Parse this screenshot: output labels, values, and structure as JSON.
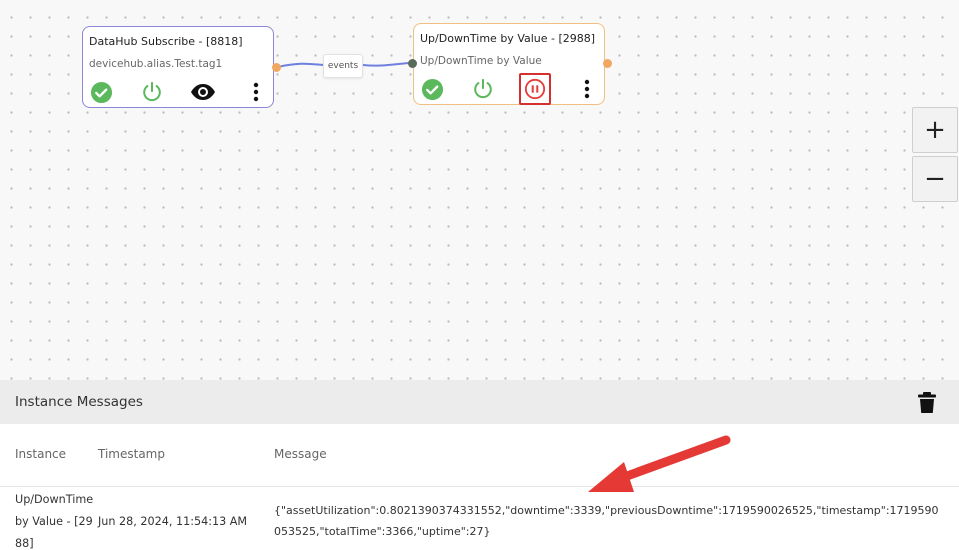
{
  "nodes": [
    {
      "title": "DataHub Subscribe - [8818]",
      "subtitle": "devicehub.alias.Test.tag1"
    },
    {
      "title": "Up/DownTime by Value - [2988]",
      "subtitle": "Up/DownTime by Value"
    }
  ],
  "edge": {
    "label": "events"
  },
  "zoom": {
    "in_label": "+",
    "out_label": "−"
  },
  "panel": {
    "title": "Instance Messages",
    "columns": {
      "instance": "Instance",
      "timestamp": "Timestamp",
      "message": "Message"
    },
    "rows": [
      {
        "instance": "Up/DownTime by Value - [2988]",
        "timestamp": "Jun 28, 2024, 11:54:13 AM",
        "message": "{\"assetUtilization\":0.8021390374331552,\"downtime\":3339,\"previousDowntime\":1719590026525,\"timestamp\":1719590053525,\"totalTime\":3366,\"uptime\":27}"
      }
    ]
  },
  "colors": {
    "check": "#5cb85c",
    "power": "#5cb85c",
    "pause": "#e53b3b",
    "highlight": "#d62f2f",
    "node_a_border": "#8b86d8",
    "node_b_border": "#f0c080",
    "edge": "#6f7fe0",
    "arrow": "#e53935"
  },
  "icons": [
    "check-circle-icon",
    "power-icon",
    "eye-icon",
    "kebab-menu-icon",
    "pause-circle-icon",
    "trash-icon"
  ]
}
